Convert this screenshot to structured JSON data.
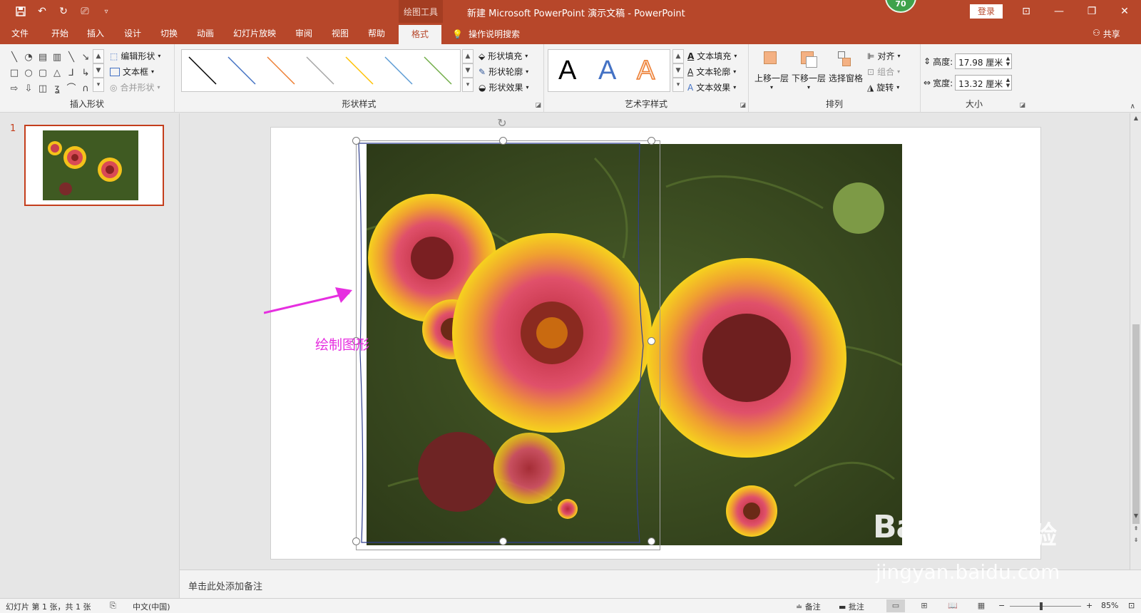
{
  "titlebar": {
    "context_tool": "绘图工具",
    "doc_title": "新建 Microsoft PowerPoint 演示文稿  -  PowerPoint",
    "badge": "70",
    "login": "登录"
  },
  "tabs": [
    {
      "label": "文件"
    },
    {
      "label": "开始"
    },
    {
      "label": "插入"
    },
    {
      "label": "设计"
    },
    {
      "label": "切换"
    },
    {
      "label": "动画"
    },
    {
      "label": "幻灯片放映"
    },
    {
      "label": "审阅"
    },
    {
      "label": "视图"
    },
    {
      "label": "帮助"
    },
    {
      "label": "格式",
      "active": true
    }
  ],
  "tell_me": "操作说明搜索",
  "share": "共享",
  "ribbon": {
    "insert_shapes": {
      "label": "插入形状",
      "edit_shape": "编辑形状",
      "text_box": "文本框",
      "merge_shapes": "合并形状"
    },
    "shape_styles": {
      "label": "形状样式",
      "fill": "形状填充",
      "outline": "形状轮廓",
      "effects": "形状效果",
      "line_colors": [
        "#000000",
        "#4472c4",
        "#ed7d31",
        "#a5a5a5",
        "#ffc000",
        "#5b9bd5",
        "#70ad47"
      ]
    },
    "wordart_styles": {
      "label": "艺术字样式",
      "letters": [
        "A",
        "A",
        "A"
      ],
      "text_fill": "文本填充",
      "text_outline": "文本轮廓",
      "text_effects": "文本效果"
    },
    "arrange": {
      "label": "排列",
      "bring_forward": "上移一层",
      "send_backward": "下移一层",
      "selection_pane": "选择窗格",
      "align": "对齐",
      "group": "组合",
      "rotate": "旋转"
    },
    "size": {
      "label": "大小",
      "height_label": "高度:",
      "height_value": "17.98 厘米",
      "width_label": "宽度:",
      "width_value": "13.32 厘米"
    }
  },
  "slides_pane": {
    "slide_number": "1"
  },
  "canvas": {
    "annotation": "绘制图形"
  },
  "notes": {
    "placeholder": "单击此处添加备注"
  },
  "status": {
    "slide_info": "幻灯片 第 1 张，共 1 张",
    "language": "中文(中国)",
    "notes_btn": "备注",
    "comments_btn": "批注",
    "zoom": "85%"
  },
  "watermark": {
    "logo": "Baidu",
    "cn": "经验",
    "url": "jingyan.baidu.com"
  }
}
